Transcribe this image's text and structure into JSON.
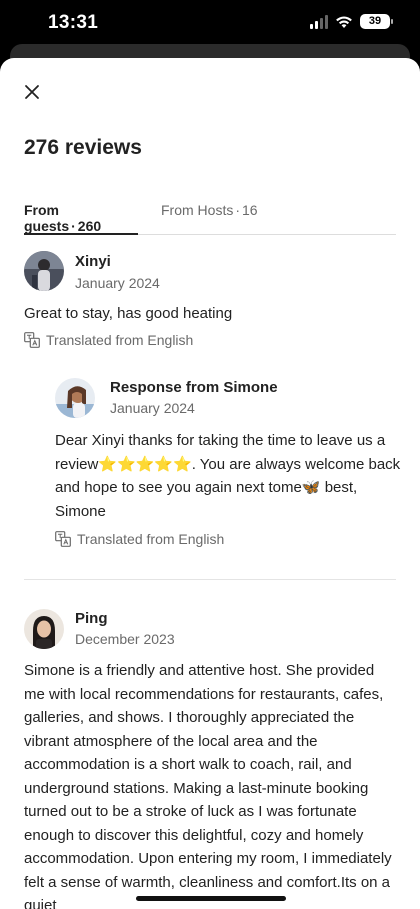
{
  "status_bar": {
    "time": "13:31",
    "battery": "39"
  },
  "header": {
    "title": "276 reviews"
  },
  "tabs": [
    {
      "label": "From guests",
      "count": "260"
    },
    {
      "label": "From Hosts",
      "count": "16"
    }
  ],
  "tab_separator": "·",
  "reviews": [
    {
      "name": "Xinyi",
      "date": "January 2024",
      "text": "Great to stay, has good heating",
      "translated": "Translated from English",
      "response": {
        "title": "Response from Simone",
        "date": "January 2024",
        "text": "Dear Xinyi thanks for taking the time to leave us a review⭐⭐⭐⭐⭐. You are always welcome back and hope to see you again next tome🦋 best, Simone",
        "translated": "Translated from English"
      }
    },
    {
      "name": "Ping",
      "date": "December 2023",
      "text": "Simone is a  friendly and attentive host. She provided me with local recommendations for restaurants, cafes, galleries, and shows. I thoroughly appreciated the vibrant atmosphere of the  local area and the accommodation is a short walk to coach, rail, and underground stations.  Making a last-minute booking turned out to be a stroke of luck as I was fortunate enough to discover this delightful, cozy and homely accommodation. Upon entering my room, I immediately felt a sense of warmth, cleanliness and comfort.Its on a quiet"
    }
  ],
  "icons": {
    "close": "close-icon",
    "translate": "translate-icon",
    "wifi": "wifi-icon",
    "signal": "signal-icon",
    "battery": "battery-icon"
  },
  "colors": {
    "text": "#222222",
    "muted": "#6a6a6a",
    "divider": "#e4e4e4"
  }
}
